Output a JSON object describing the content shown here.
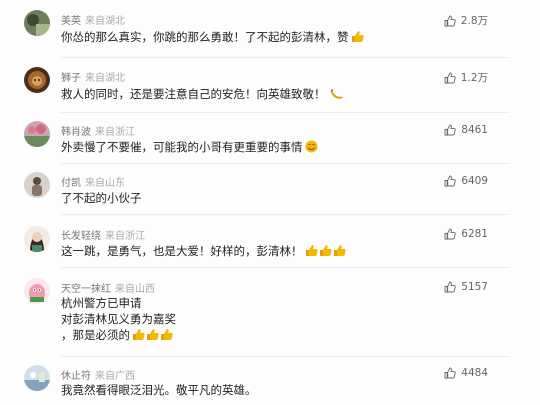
{
  "comments": [
    {
      "name": "美英",
      "location": "来自湖北",
      "lines": [
        "你怂的那么真实，你跳的那么勇敢！了不起的彭清林，赞"
      ],
      "likes": "2.8万",
      "emoji": "thumbs-up-emoji",
      "avatar_color": "#6f7f5c"
    },
    {
      "name": "狮子",
      "location": "来自湖北",
      "lines": [
        "救人的同时，还是要注意自己的安危！向英雄致敬！"
      ],
      "likes": "1.2万",
      "emoji": "banana-emoji",
      "avatar_color": "#7a4a2a"
    },
    {
      "name": "韩肖波",
      "location": "来自浙江",
      "lines": [
        "外卖慢了不要催，可能我的小哥有更重要的事情"
      ],
      "likes": "8461",
      "emoji": "smile-emoji",
      "avatar_color": "#b8a0a8"
    },
    {
      "name": "付凯",
      "location": "来自山东",
      "lines": [
        "了不起的小伙子"
      ],
      "likes": "6409",
      "emoji": "",
      "avatar_color": "#c8c4c0"
    },
    {
      "name": "长发轻绕",
      "location": "来自浙江",
      "lines": [
        "这一跳，是勇气，也是大爱！好样的，彭清林！"
      ],
      "likes": "6281",
      "emoji": "thumbs-up-emoji-x3",
      "avatar_color": "#e8d8c8"
    },
    {
      "name": "天空一抹红",
      "location": "来自山西",
      "lines": [
        "杭州警方已申请",
        "对彭清林见义勇为嘉奖",
        "，那是必须的"
      ],
      "likes": "5157",
      "emoji": "thumbs-up-emoji-x3",
      "avatar_color": "#e0a0b0"
    },
    {
      "name": "休止符",
      "location": "来自广西",
      "lines": [
        "我竟然看得眼泛泪光。敬平凡的英雄。"
      ],
      "likes": "4484",
      "emoji": "",
      "avatar_color": "#9fb7c8"
    }
  ],
  "colors": {
    "name": "#777777",
    "location": "#aaaaaa",
    "text": "#222222",
    "likes": "#666666",
    "emoji": "#f5b800"
  }
}
